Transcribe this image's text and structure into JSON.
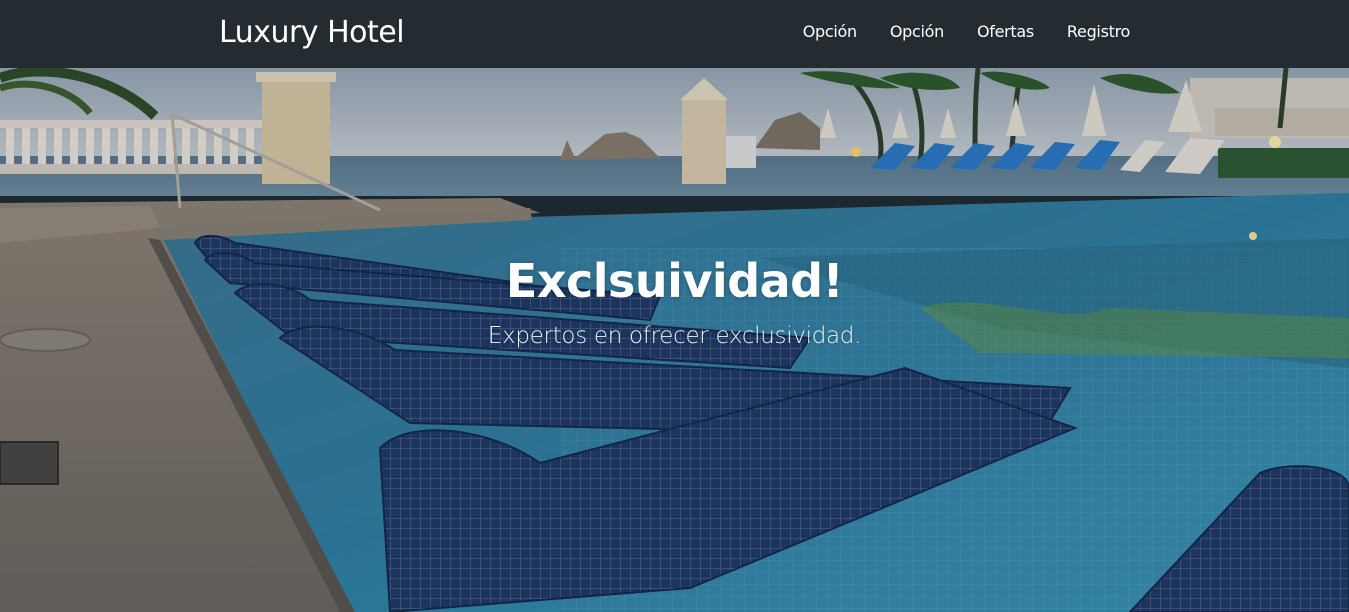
{
  "navbar": {
    "brand": "Luxury Hotel",
    "links": [
      "Opción",
      "Opción",
      "Ofertas",
      "Registro"
    ]
  },
  "hero": {
    "title": "Exclsuividad!",
    "subtitle": "Expertos en ofrecer exclusividad.",
    "image": "hotel-infinity-pool-photo"
  },
  "colors": {
    "navbar_bg": "#242c32",
    "text": "#ffffff"
  }
}
